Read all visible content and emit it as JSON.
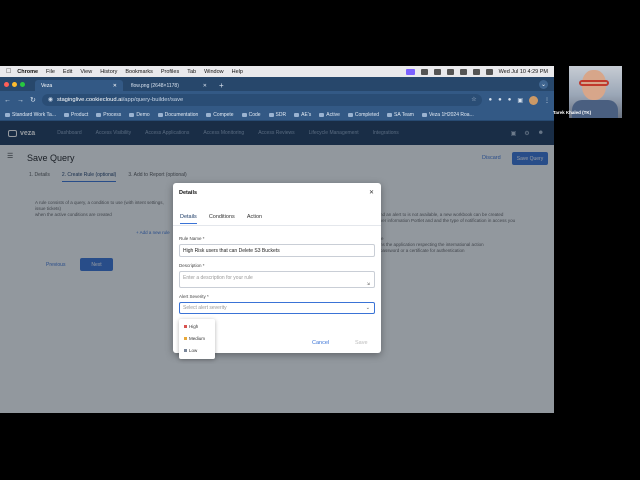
{
  "menubar": {
    "app": "Chrome",
    "items": [
      "File",
      "Edit",
      "View",
      "History",
      "Bookmarks",
      "Profiles",
      "Tab",
      "Window",
      "Help"
    ],
    "clock": "Wed Jul 10  4:29 PM"
  },
  "browser": {
    "tabs": [
      {
        "title": "Veza"
      },
      {
        "title": "flow.png (2648×1178)"
      }
    ],
    "url_host": "staginglive.cookiecloud.ai",
    "url_path": "/app/query-builder/save",
    "bookmarks": [
      "Standard Work Ta...",
      "Product",
      "Process",
      "Demo",
      "Documentation",
      "Compete",
      "Code",
      "SDR",
      "AE's",
      "Active",
      "Completed",
      "SA Team",
      "Veza 1H2024 Roa..."
    ]
  },
  "app": {
    "logo": "veza",
    "nav": [
      "Dashboard",
      "Access Visibility",
      "Access Applications",
      "Access Monitoring",
      "Access Reviews",
      "Lifecycle Management",
      "Integrations"
    ],
    "page_title": "Save Query",
    "discard": "Discard",
    "save_query": "Save Query",
    "steps": [
      "1. Details",
      "2. Create Rule (optional)",
      "3. Add to Report (optional)"
    ],
    "bg_text_left_1": "A rule consists of a query, a condition to use (with intent settings, issue tickets)",
    "bg_text_left_2": "when the active conditions are created",
    "bg_add_link": "+ Add a new rule",
    "bg_text_right_1": "nd an alert to is not available, a new workbook can be created",
    "bg_text_right_2": "ver information Portlet and and the type of notification in access you",
    "bg_text_right_3": "le",
    "bg_text_right_4": "ns the application respecting the international action",
    "bg_text_right_5": "password or a certificate for authentication",
    "previous": "Previous",
    "next": "Next"
  },
  "modal": {
    "title": "Details",
    "tabs": [
      "Details",
      "Conditions",
      "Action"
    ],
    "rule_name_label": "Rule Name *",
    "rule_name_value": "High Risk users that can Delete S3 Buckets",
    "description_label": "Description *",
    "description_placeholder": "Enter a description for your rule",
    "severity_label": "Alert Severity *",
    "severity_placeholder": "Select alert severity",
    "cancel": "Cancel",
    "submit": "Save",
    "severity_options": [
      {
        "label": "High",
        "color": "#d9534f"
      },
      {
        "label": "Medium",
        "color": "#e8a838"
      },
      {
        "label": "Low",
        "color": "#7a8699"
      }
    ]
  },
  "video": {
    "participant": "Tarek Khaled (TK)"
  }
}
